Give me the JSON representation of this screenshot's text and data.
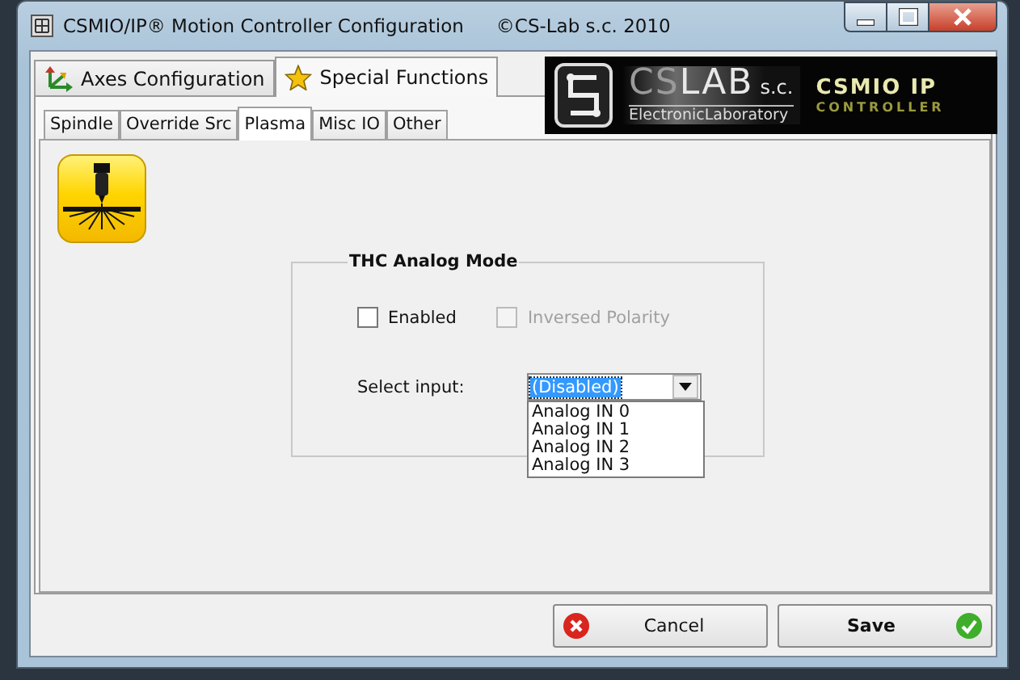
{
  "window": {
    "title": "CSMIO/IP® Motion Controller Configuration",
    "copyright": "©CS-Lab s.c. 2010"
  },
  "tabs": [
    {
      "label": "Axes Configuration",
      "kind": "axes",
      "selected": false
    },
    {
      "label": "Special Functions",
      "kind": "star",
      "selected": true
    }
  ],
  "logo": {
    "brand_light": "CS",
    "brand": "LAB",
    "suffix": "s.c.",
    "subtitle": "ElectronicLaboratory",
    "product": "CSMIO IP",
    "product_sub": "CONTROLLER"
  },
  "subtabs": [
    {
      "label": "Spindle",
      "selected": false
    },
    {
      "label": "Override Src",
      "selected": false
    },
    {
      "label": "Plasma",
      "selected": true
    },
    {
      "label": "Misc IO",
      "selected": false
    },
    {
      "label": "Other",
      "selected": false
    }
  ],
  "group": {
    "title": "THC Analog Mode",
    "checkboxes": [
      {
        "label": "Enabled",
        "checked": false,
        "disabled": false
      },
      {
        "label": "Inversed Polarity",
        "checked": false,
        "disabled": true
      }
    ],
    "select_label": "Select input:",
    "combo": {
      "value": "(Disabled)",
      "expanded": true
    },
    "options": [
      "Analog IN 0",
      "Analog IN 1",
      "Analog IN 2",
      "Analog IN 3"
    ]
  },
  "buttons": [
    {
      "label": "Cancel",
      "kind": "cancel"
    },
    {
      "label": "Save",
      "kind": "save"
    }
  ]
}
